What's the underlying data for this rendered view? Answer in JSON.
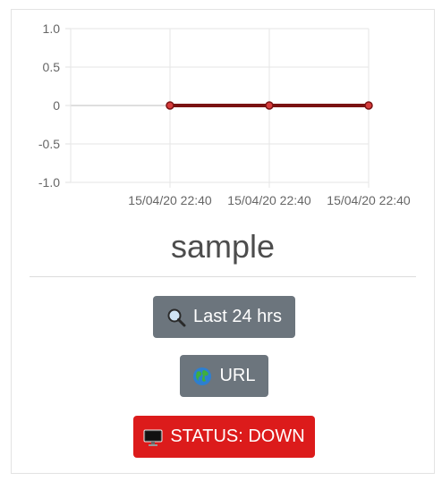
{
  "chart_data": {
    "type": "line",
    "x": [
      "15/04/20 22:40",
      "15/04/20 22:40",
      "15/04/20 22:40"
    ],
    "series": [
      {
        "values": [
          0,
          0,
          0
        ]
      }
    ],
    "ylim": [
      -1.0,
      1.0
    ],
    "yticks": [
      "1.0",
      "0.5",
      "0",
      "-0.5",
      "-1.0"
    ],
    "grid": true,
    "line_color": "#7a1212",
    "point_color": "#d63b3b"
  },
  "title": "sample",
  "buttons": {
    "history_label": "Last 24 hrs",
    "url_label": "URL",
    "status_label": "STATUS: DOWN"
  },
  "icons": {
    "history": "magnifier-icon",
    "url": "globe-icon",
    "status": "monitor-icon"
  },
  "colors": {
    "button_gray": "#6c757d",
    "status_down": "#dc1b1b"
  }
}
